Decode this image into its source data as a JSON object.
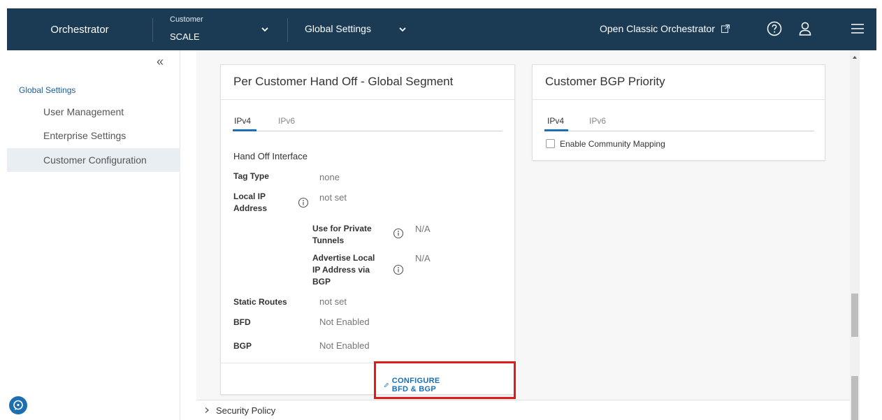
{
  "header": {
    "brand": "Orchestrator",
    "customer_label": "Customer",
    "customer_value": "SCALE",
    "global_settings": "Global Settings",
    "classic_link": "Open Classic Orchestrator",
    "icons": [
      "external-link-icon",
      "help-icon",
      "user-icon",
      "menu-icon"
    ]
  },
  "sidebar": {
    "collapse_icon": "double-chevron-left-icon",
    "section_title": "Global Settings",
    "items": [
      {
        "label": "User Management",
        "active": false
      },
      {
        "label": "Enterprise Settings",
        "active": false
      },
      {
        "label": "Customer Configuration",
        "active": true
      }
    ]
  },
  "handoff_card": {
    "title": "Per Customer Hand Off - Global Segment",
    "tabs": [
      "IPv4",
      "IPv6"
    ],
    "active_tab": "IPv4",
    "section": "Hand Off Interface",
    "fields": {
      "tag_type_label": "Tag Type",
      "tag_type_value": "none",
      "local_ip_label_line1": "Local IP",
      "local_ip_label_line2": "Address",
      "local_ip_value": "not set",
      "private_tunnels_line1": "Use for Private",
      "private_tunnels_line2": "Tunnels",
      "private_tunnels_value": "N/A",
      "advertise_line1": "Advertise Local",
      "advertise_line2": "IP Address via",
      "advertise_line3": "BGP",
      "advertise_value": "N/A",
      "static_routes_label": "Static Routes",
      "static_routes_value": "not set",
      "bfd_label": "BFD",
      "bfd_value": "Not Enabled",
      "bgp_label": "BGP",
      "bgp_value": "Not Enabled"
    },
    "configure_link": "CONFIGURE BFD & BGP"
  },
  "bgp_priority_card": {
    "title": "Customer BGP Priority",
    "tabs": [
      "IPv4",
      "IPv6"
    ],
    "active_tab": "IPv4",
    "checkbox_label": "Enable Community Mapping",
    "checkbox_checked": false
  },
  "security_policy": {
    "label": "Security Policy"
  },
  "colors": {
    "header_bg": "#1b3b55",
    "accent": "#1a6fb7",
    "highlight": "#e01b1b"
  }
}
